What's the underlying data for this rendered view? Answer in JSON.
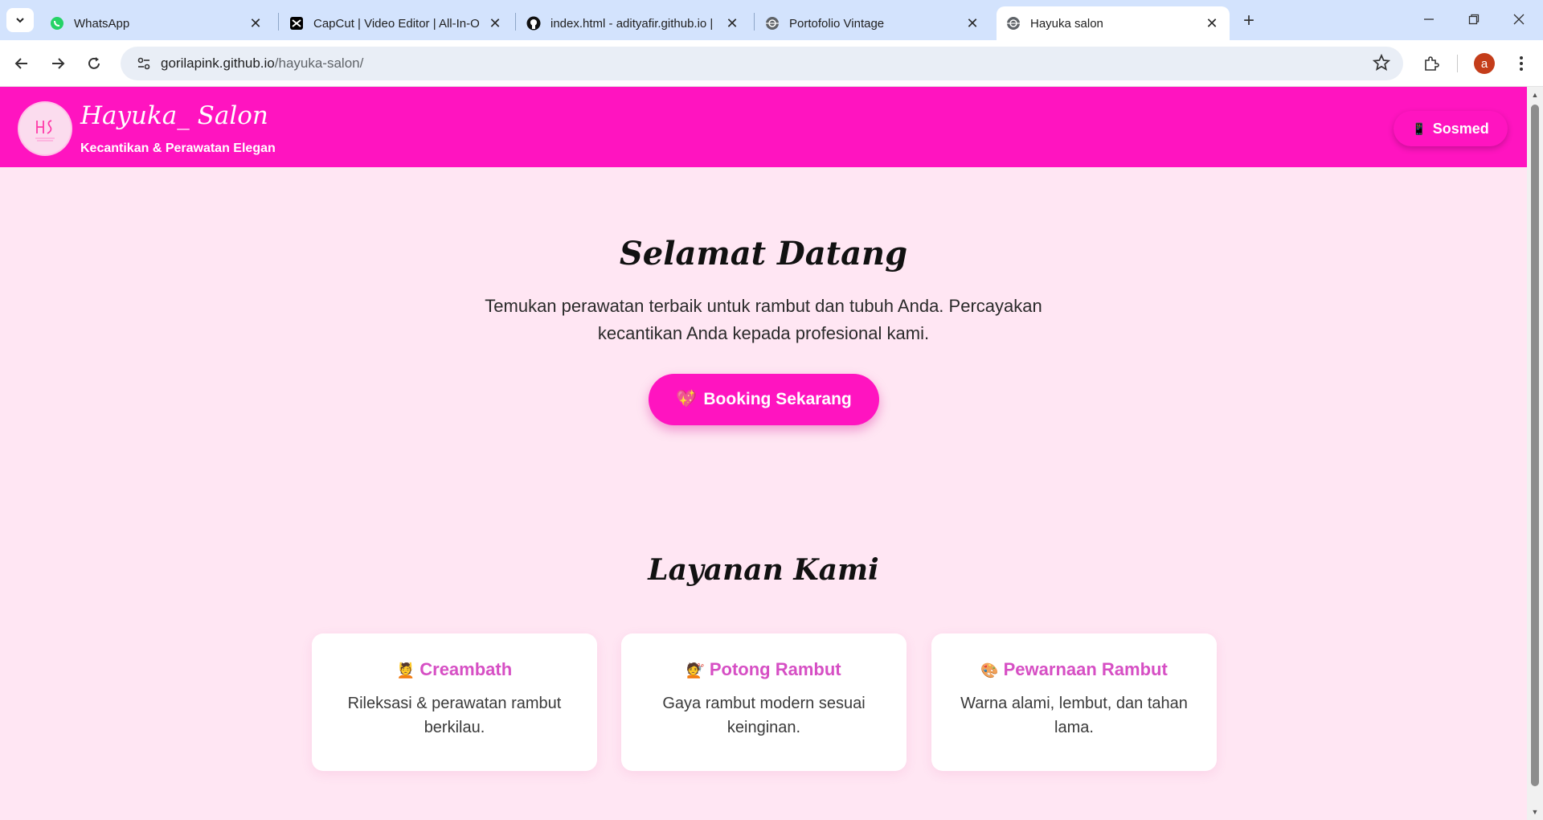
{
  "browser": {
    "tabs": [
      {
        "title": "WhatsApp",
        "icon": "whatsapp-icon",
        "color": "#25d366"
      },
      {
        "title": "CapCut | Video Editor | All-In-O",
        "icon": "capcut-icon",
        "color": "#000000"
      },
      {
        "title": "index.html - adityafir.github.io |",
        "icon": "github-icon",
        "color": "#000000"
      },
      {
        "title": "Portofolio Vintage",
        "icon": "globe-icon",
        "color": "#5f6368"
      },
      {
        "title": "Hayuka salon",
        "icon": "globe-icon",
        "color": "#5f6368",
        "active": true
      }
    ],
    "url_host": "gorilapink.github.io",
    "url_path": "/hayuka-salon/",
    "profile_initial": "a"
  },
  "site": {
    "brand": "Hayuka_ Salon",
    "tagline": "Kecantikan & Perawatan Elegan",
    "sosmed_label": "Sosmed",
    "sosmed_icon": "📱",
    "hero_title": "Selamat Datang",
    "hero_desc": "Temukan perawatan terbaik untuk rambut dan tubuh Anda. Percayakan kecantikan Anda kepada profesional kami.",
    "booking_label": "Booking Sekarang",
    "booking_icon": "💖",
    "services_title": "Layanan Kami",
    "services": [
      {
        "icon": "💆",
        "name": "Creambath",
        "desc": "Rileksasi & perawatan rambut berkilau."
      },
      {
        "icon": "💇",
        "name": "Potong Rambut",
        "desc": "Gaya rambut modern sesuai keinginan."
      },
      {
        "icon": "🎨",
        "name": "Pewarnaan Rambut",
        "desc": "Warna alami, lembut, dan tahan lama."
      }
    ]
  },
  "colors": {
    "header_pink": "#ff14c0",
    "page_bg": "#ffe6f3",
    "service_title": "#d64fc4",
    "tabstrip": "#d3e3fd"
  }
}
